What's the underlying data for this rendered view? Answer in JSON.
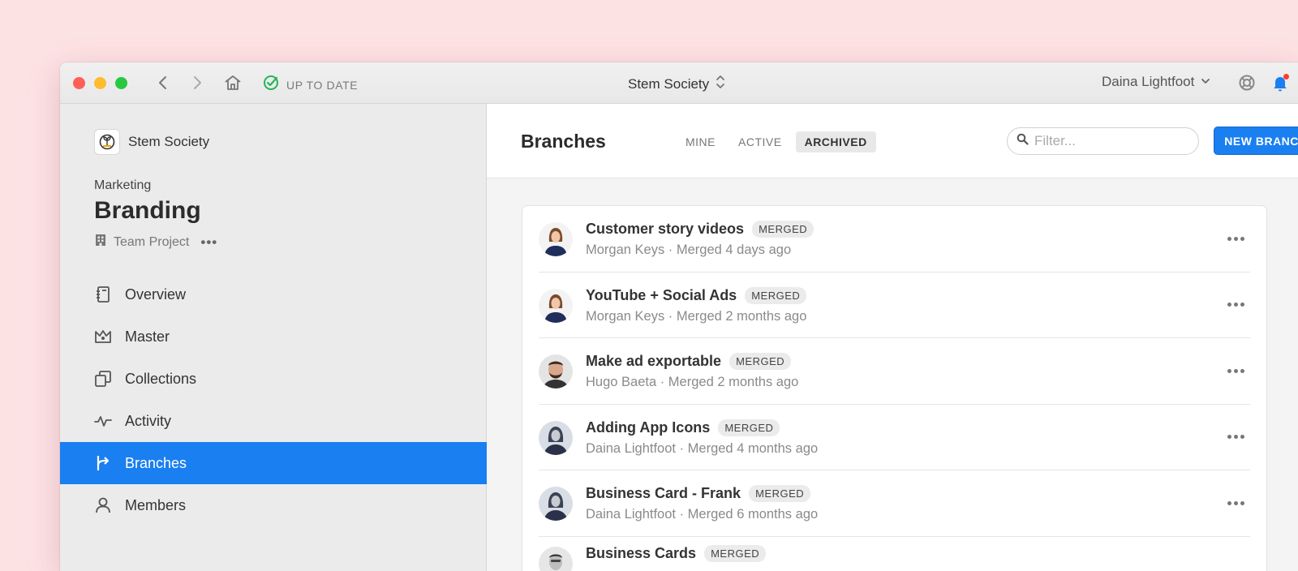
{
  "titlebar": {
    "status_label": "UP TO DATE",
    "org_switcher": "Stem Society",
    "user_name": "Daina Lightfoot"
  },
  "sidebar": {
    "org_name": "Stem Society",
    "project_parent": "Marketing",
    "project_name": "Branding",
    "project_type": "Team Project",
    "items": [
      {
        "label": "Overview",
        "icon": "notebook-icon"
      },
      {
        "label": "Master",
        "icon": "crown-icon"
      },
      {
        "label": "Collections",
        "icon": "collections-icon"
      },
      {
        "label": "Activity",
        "icon": "pulse-icon"
      },
      {
        "label": "Branches",
        "icon": "branch-icon",
        "active": true
      },
      {
        "label": "Members",
        "icon": "person-icon"
      }
    ]
  },
  "main": {
    "title": "Branches",
    "tabs": [
      {
        "label": "MINE"
      },
      {
        "label": "ACTIVE"
      },
      {
        "label": "ARCHIVED",
        "selected": true
      }
    ],
    "filter_placeholder": "Filter...",
    "new_branch_label": "NEW BRANCH...",
    "branches": [
      {
        "name": "Customer story videos",
        "badge": "MERGED",
        "meta": "Morgan Keys · Merged 4 days ago"
      },
      {
        "name": "YouTube + Social Ads",
        "badge": "MERGED",
        "meta": "Morgan Keys · Merged 2 months ago"
      },
      {
        "name": "Make ad exportable",
        "badge": "MERGED",
        "meta": "Hugo Baeta · Merged 2 months ago"
      },
      {
        "name": "Adding App Icons",
        "badge": "MERGED",
        "meta": "Daina Lightfoot · Merged 4 months ago"
      },
      {
        "name": "Business Card - Frank",
        "badge": "MERGED",
        "meta": "Daina Lightfoot · Merged 6 months ago"
      },
      {
        "name": "Business Cards",
        "badge": "MERGED",
        "meta": ""
      }
    ]
  },
  "colors": {
    "accent": "#1a7ff0",
    "status_green": "#27b35a",
    "background": "#fde2e4"
  }
}
